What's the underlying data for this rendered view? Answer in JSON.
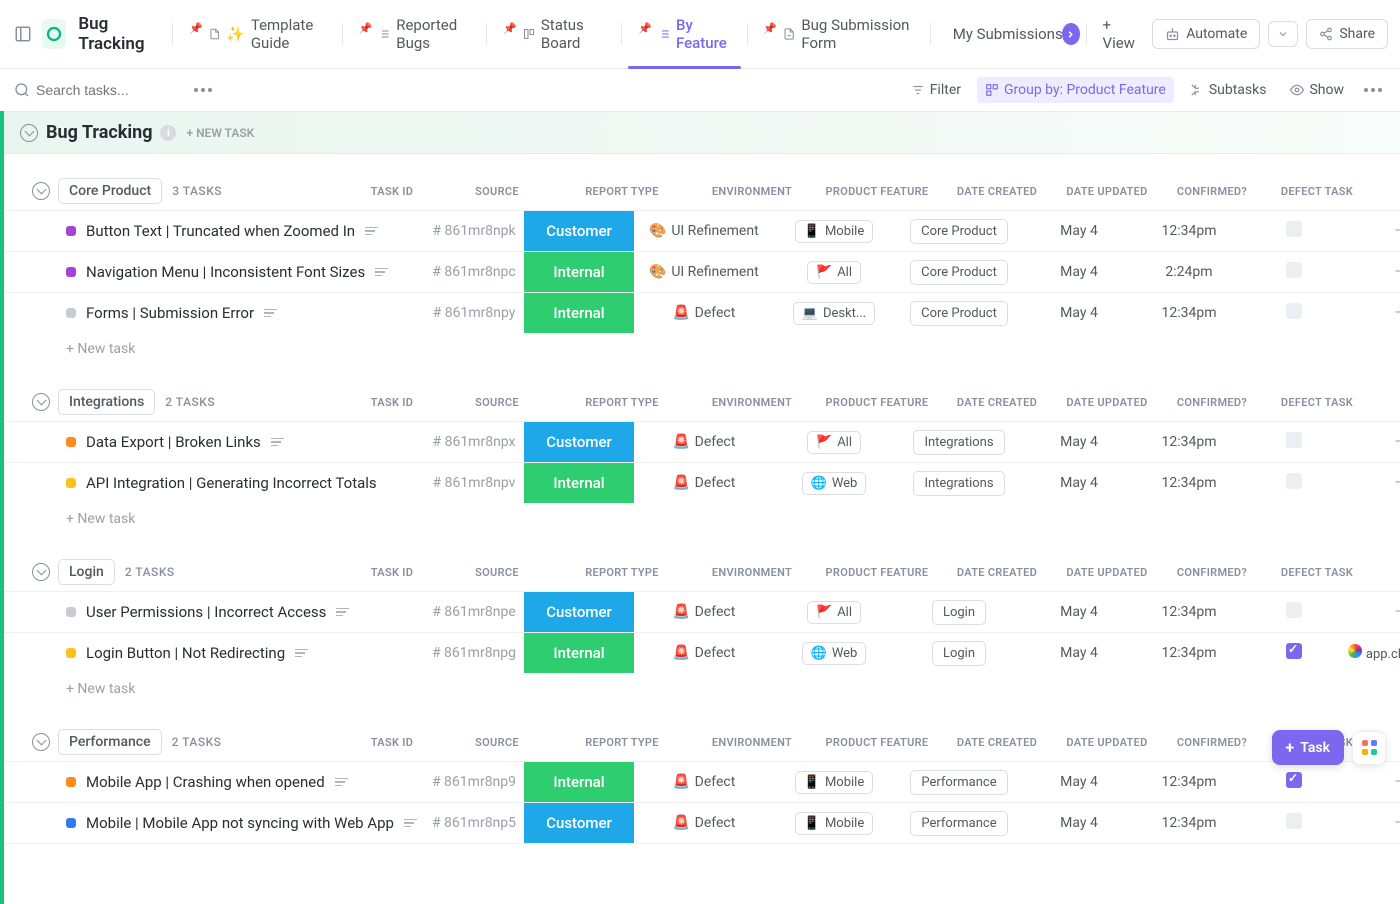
{
  "header": {
    "app_title": "Bug Tracking",
    "tabs": [
      {
        "label": "Template Guide",
        "pinned": true
      },
      {
        "label": "Reported Bugs",
        "pinned": true
      },
      {
        "label": "Status Board",
        "pinned": true
      },
      {
        "label": "By Feature",
        "pinned": true,
        "active": true
      },
      {
        "label": "Bug Submission Form",
        "pinned": true
      },
      {
        "label": "My Submissions",
        "pinned": false
      }
    ],
    "add_view": "+ View",
    "automate": "Automate",
    "share": "Share"
  },
  "toolbar": {
    "search_placeholder": "Search tasks...",
    "filter": "Filter",
    "group_by": "Group by: Product Feature",
    "subtasks": "Subtasks",
    "show": "Show"
  },
  "list": {
    "title": "Bug Tracking",
    "new_task": "+ NEW TASK"
  },
  "columns": {
    "task_id": "TASK ID",
    "source": "SOURCE",
    "report_type": "REPORT TYPE",
    "environment": "ENVIRONMENT",
    "product_feature": "PRODUCT FEATURE",
    "date_created": "DATE CREATED",
    "date_updated": "DATE UPDATED",
    "confirmed": "CONFIRMED?",
    "defect_task": "DEFECT TASK"
  },
  "groups": [
    {
      "name": "Core Product",
      "count_label": "3 TASKS",
      "tasks": [
        {
          "color": "#a244d6",
          "name": "Button Text | Truncated when Zoomed In",
          "desc": true,
          "task_id": "# 861mr8npk",
          "source": "Customer",
          "report_type": "UI Refinement",
          "rt_emoji": "🎨",
          "env": "Mobile",
          "env_emoji": "📱",
          "feature": "Core Product",
          "created": "May 4",
          "updated": "12:34pm",
          "confirmed": false,
          "defect": "–"
        },
        {
          "color": "#a244d6",
          "name": "Navigation Menu | Inconsistent Font Sizes",
          "desc": true,
          "task_id": "# 861mr8npc",
          "source": "Internal",
          "report_type": "UI Refinement",
          "rt_emoji": "🎨",
          "env": "All",
          "env_emoji": "🚩",
          "feature": "Core Product",
          "created": "May 4",
          "updated": "2:24pm",
          "confirmed": false,
          "defect": "–"
        },
        {
          "color": "#c7ccd2",
          "name": "Forms | Submission Error",
          "desc": true,
          "task_id": "# 861mr8npy",
          "source": "Internal",
          "report_type": "Defect",
          "rt_emoji": "🚨",
          "env": "Deskt...",
          "env_emoji": "💻",
          "feature": "Core Product",
          "created": "May 4",
          "updated": "12:34pm",
          "confirmed": false,
          "defect": "–"
        }
      ],
      "new_task": "+ New task"
    },
    {
      "name": "Integrations",
      "count_label": "2 TASKS",
      "tasks": [
        {
          "color": "#ff8b1f",
          "name": "Data Export | Broken Links",
          "desc": true,
          "task_id": "# 861mr8npx",
          "source": "Customer",
          "report_type": "Defect",
          "rt_emoji": "🚨",
          "env": "All",
          "env_emoji": "🚩",
          "feature": "Integrations",
          "created": "May 4",
          "updated": "12:34pm",
          "confirmed": false,
          "defect": "–"
        },
        {
          "color": "#ffc21a",
          "name": "API Integration | Generating Incorrect Totals",
          "desc": false,
          "task_id": "# 861mr8npv",
          "source": "Internal",
          "report_type": "Defect",
          "rt_emoji": "🚨",
          "env": "Web",
          "env_emoji": "🌐",
          "feature": "Integrations",
          "created": "May 4",
          "updated": "12:34pm",
          "confirmed": false,
          "defect": "–"
        }
      ],
      "new_task": "+ New task"
    },
    {
      "name": "Login",
      "count_label": "2 TASKS",
      "tasks": [
        {
          "color": "#c7ccd2",
          "name": "User Permissions | Incorrect Access",
          "desc": true,
          "task_id": "# 861mr8npe",
          "source": "Customer",
          "report_type": "Defect",
          "rt_emoji": "🚨",
          "env": "All",
          "env_emoji": "🚩",
          "feature": "Login",
          "created": "May 4",
          "updated": "12:34pm",
          "confirmed": false,
          "defect": "–"
        },
        {
          "color": "#ffc21a",
          "name": "Login Button | Not Redirecting",
          "desc": true,
          "task_id": "# 861mr8npg",
          "source": "Internal",
          "report_type": "Defect",
          "rt_emoji": "🚨",
          "env": "Web",
          "env_emoji": "🌐",
          "feature": "Login",
          "created": "May 4",
          "updated": "12:34pm",
          "confirmed": true,
          "defect": "app.clickup.co",
          "defect_icon": true
        }
      ],
      "new_task": "+ New task"
    },
    {
      "name": "Performance",
      "count_label": "2 TASKS",
      "tasks": [
        {
          "color": "#ff8b1f",
          "name": "Mobile App | Crashing when opened",
          "desc": true,
          "task_id": "# 861mr8np9",
          "source": "Internal",
          "report_type": "Defect",
          "rt_emoji": "🚨",
          "env": "Mobile",
          "env_emoji": "📱",
          "feature": "Performance",
          "created": "May 4",
          "updated": "12:34pm",
          "confirmed": true,
          "defect": "–"
        },
        {
          "color": "#3478f5",
          "name": "Mobile | Mobile App not syncing with Web App",
          "desc": true,
          "task_id": "# 861mr8np5",
          "source": "Customer",
          "report_type": "Defect",
          "rt_emoji": "🚨",
          "env": "Mobile",
          "env_emoji": "📱",
          "feature": "Performance",
          "created": "May 4",
          "updated": "12:34pm",
          "confirmed": false,
          "defect": "–"
        }
      ],
      "new_task": ""
    }
  ],
  "fab": {
    "task": "Task"
  }
}
